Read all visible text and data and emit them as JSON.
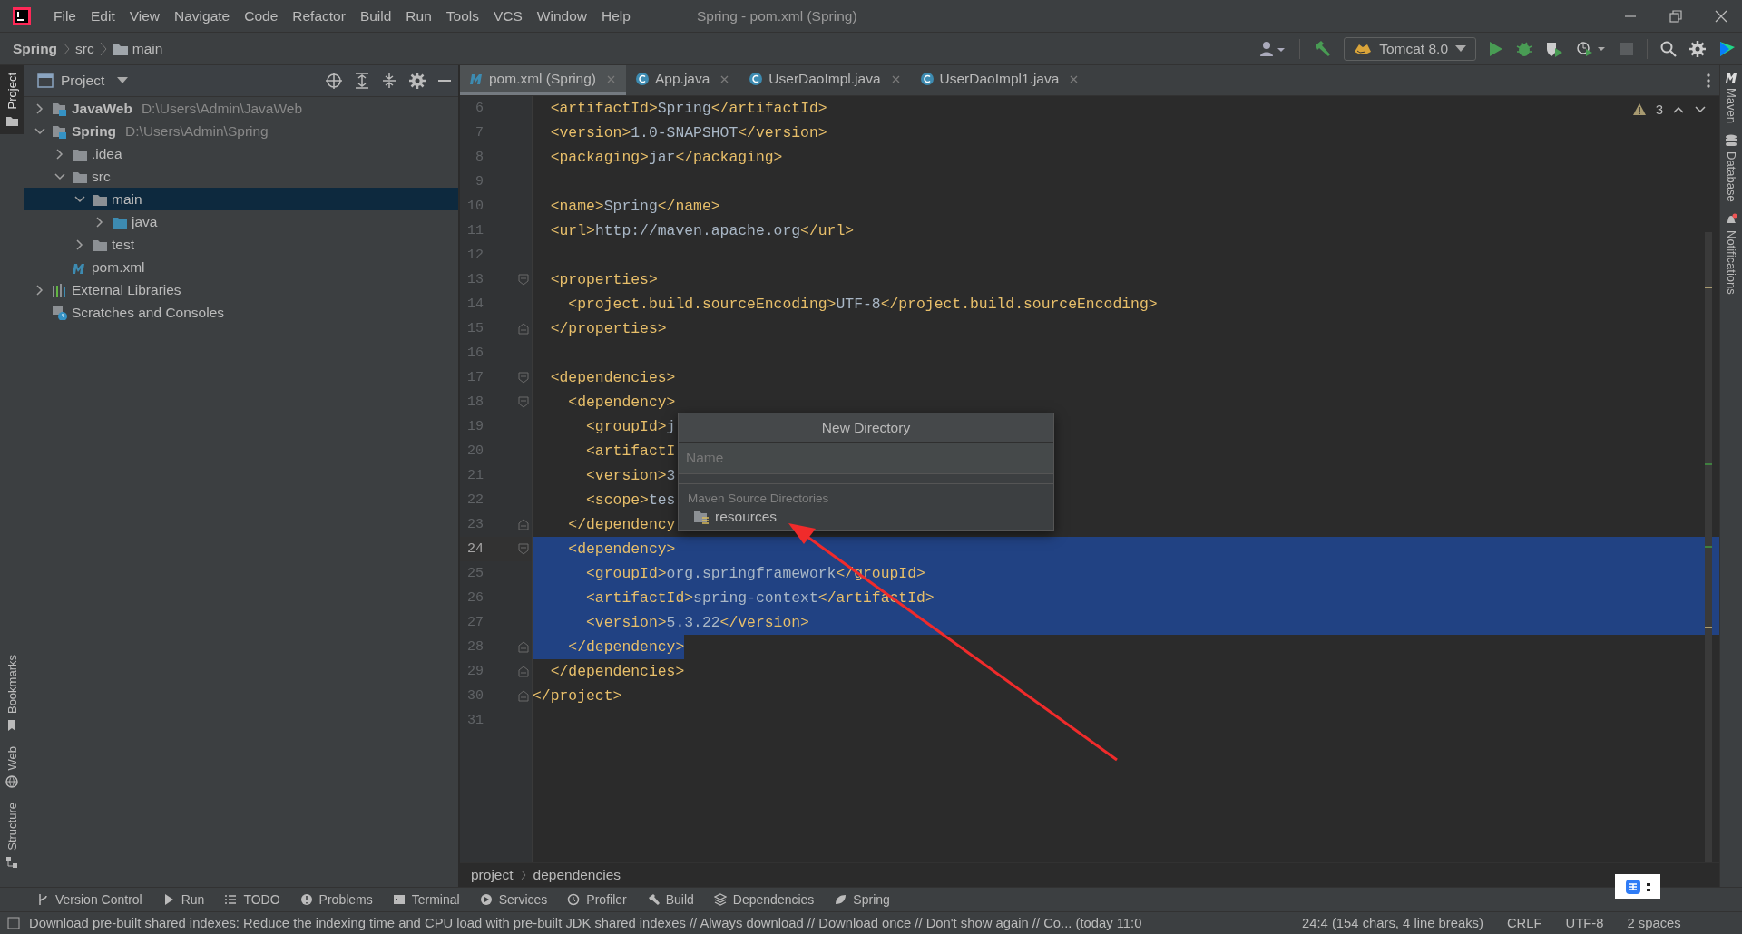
{
  "window": {
    "title": "Spring - pom.xml (Spring)"
  },
  "menu": [
    "File",
    "Edit",
    "View",
    "Navigate",
    "Code",
    "Refactor",
    "Build",
    "Run",
    "Tools",
    "VCS",
    "Window",
    "Help"
  ],
  "breadcrumb": [
    {
      "label": "Spring",
      "bold": true
    },
    {
      "label": "src",
      "bold": false
    },
    {
      "label": "main",
      "bold": false
    }
  ],
  "run_config": {
    "label": "Tomcat 8.0"
  },
  "left_stripe": [
    {
      "label": "Project",
      "selected": true
    },
    {
      "label": "Bookmarks",
      "selected": false
    },
    {
      "label": "Web",
      "selected": false
    },
    {
      "label": "Structure",
      "selected": false
    }
  ],
  "right_stripe": [
    {
      "label": "Maven"
    },
    {
      "label": "Database"
    },
    {
      "label": "Notifications"
    }
  ],
  "project_panel": {
    "title": "Project",
    "tree": [
      {
        "name": "JavaWeb",
        "path": "D:\\Users\\Admin\\JavaWeb",
        "kind": "module",
        "expanded": false,
        "selected": false
      },
      {
        "name": "Spring",
        "path": "D:\\Users\\Admin\\Spring",
        "kind": "module",
        "expanded": true,
        "selected": false,
        "children": [
          {
            "name": ".idea",
            "kind": "folder",
            "expanded": false,
            "selected": false
          },
          {
            "name": "src",
            "kind": "folder",
            "expanded": true,
            "selected": false,
            "children": [
              {
                "name": "main",
                "kind": "folder",
                "expanded": true,
                "selected": true,
                "children": [
                  {
                    "name": "java",
                    "kind": "source-folder",
                    "expanded": false,
                    "selected": false
                  }
                ]
              },
              {
                "name": "test",
                "kind": "folder",
                "expanded": false,
                "selected": false
              }
            ]
          },
          {
            "name": "pom.xml",
            "kind": "maven",
            "selected": false
          }
        ]
      },
      {
        "name": "External Libraries",
        "kind": "libraries",
        "expanded": false,
        "selected": false
      },
      {
        "name": "Scratches and Consoles",
        "kind": "scratches",
        "selected": false
      }
    ]
  },
  "tabs": [
    {
      "label": "pom.xml (Spring)",
      "kind": "maven",
      "selected": true
    },
    {
      "label": "App.java",
      "kind": "class",
      "selected": false
    },
    {
      "label": "UserDaoImpl.java",
      "kind": "class",
      "selected": false
    },
    {
      "label": "UserDaoImpl1.java",
      "kind": "class",
      "selected": false
    }
  ],
  "inspections": {
    "warnings": "3"
  },
  "code": [
    {
      "number": "6",
      "text": "  <artifactId>Spring</artifactId>",
      "selected": false
    },
    {
      "number": "7",
      "text": "  <version>1.0-SNAPSHOT</version>",
      "selected": false
    },
    {
      "number": "8",
      "text": "  <packaging>jar</packaging>",
      "selected": false
    },
    {
      "number": "9",
      "selected": false
    },
    {
      "number": "10",
      "text": "  <name>Spring</name>",
      "selected": false
    },
    {
      "number": "11",
      "text": "  <url>http://maven.apache.org</url>",
      "selected": false
    },
    {
      "number": "12",
      "selected": false
    },
    {
      "number": "13",
      "text": "  <properties>",
      "selected": false,
      "fold_start": true
    },
    {
      "number": "14",
      "text": "    <project.build.sourceEncoding>UTF-8</project.build.sourceEncoding>",
      "selected": false
    },
    {
      "number": "15",
      "text": "  </properties>",
      "selected": false,
      "fold_end": true
    },
    {
      "number": "16",
      "selected": false
    },
    {
      "number": "17",
      "text": "  <dependencies>",
      "selected": false,
      "fold_start": true
    },
    {
      "number": "18",
      "text": "    <dependency>",
      "selected": false,
      "fold_start": true
    },
    {
      "number": "19",
      "text": "      <groupId>j",
      "selected": false
    },
    {
      "number": "20",
      "text": "      <artifactI",
      "selected": false
    },
    {
      "number": "21",
      "text": "      <version>3",
      "selected": false
    },
    {
      "number": "22",
      "text": "      <scope>tes",
      "selected": false
    },
    {
      "number": "23",
      "text": "    </dependency",
      "selected": false,
      "fold_end": true
    },
    {
      "number": "24",
      "text": "    <dependency>",
      "selected": true,
      "current": true,
      "fold_start": true
    },
    {
      "number": "25",
      "text": "      <groupId>org.springframework</groupId>",
      "selected": true
    },
    {
      "number": "26",
      "text": "      <artifactId>spring-context</artifactId>",
      "selected": true
    },
    {
      "number": "27",
      "text": "      <version>5.3.22</version>",
      "selected": true
    },
    {
      "number": "28",
      "text": "    </dependency>",
      "selected": true,
      "fold_end": true
    },
    {
      "number": "29",
      "text": "  </dependencies>",
      "selected": false,
      "fold_end": true
    },
    {
      "number": "30",
      "text": "</project>",
      "selected": false,
      "fold_end": true
    },
    {
      "number": "31",
      "selected": false
    }
  ],
  "popup": {
    "title": "New Directory",
    "placeholder": "Name",
    "group": "Maven Source Directories",
    "items": [
      {
        "label": "resources",
        "selected": false
      }
    ]
  },
  "editor_breadcrumb": [
    "project",
    "dependencies"
  ],
  "tool_windows": [
    "Version Control",
    "Run",
    "TODO",
    "Problems",
    "Terminal",
    "Services",
    "Profiler",
    "Build",
    "Dependencies",
    "Spring"
  ],
  "status_bar": {
    "message": "Download pre-built shared indexes: Reduce the indexing time and CPU load with pre-built JDK shared indexes // Always download // Download once // Don't show again // Co... (today 11:0",
    "position": "24:4 (154 chars, 4 line breaks)",
    "line_separator": "CRLF",
    "encoding": "UTF-8",
    "indent": "2 spaces"
  }
}
